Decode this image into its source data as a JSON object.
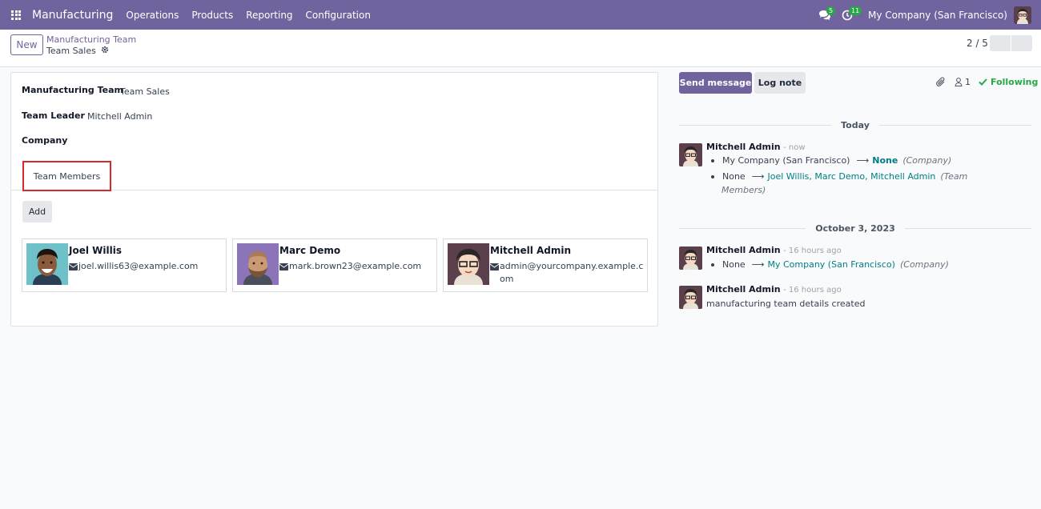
{
  "navbar": {
    "app_name": "Manufacturing",
    "menus": [
      "Operations",
      "Products",
      "Reporting",
      "Configuration"
    ],
    "messages_badge": "5",
    "activities_badge": "11",
    "company": "My Company (San Francisco)"
  },
  "control_panel": {
    "new_label": "New",
    "breadcrumb_parent": "Manufacturing Team",
    "breadcrumb_current": "Team Sales",
    "pager": "2 / 5"
  },
  "form": {
    "team_label": "Manufacturing Team",
    "team_value": "Team Sales",
    "leader_label": "Team Leader",
    "leader_value": "Mitchell Admin",
    "company_label": "Company",
    "company_value": "",
    "tab_label": "Team Members",
    "add_label": "Add",
    "members": [
      {
        "name": "Joel Willis",
        "email": "joel.willis63@example.com"
      },
      {
        "name": "Marc Demo",
        "email": "mark.brown23@example.com"
      },
      {
        "name": "Mitchell Admin",
        "email": "admin@yourcompany.example.com"
      }
    ]
  },
  "chatter": {
    "send_message": "Send message",
    "log_note": "Log note",
    "followers_count": "1",
    "following": "Following",
    "sep_today": "Today",
    "sep_oct": "October 3, 2023",
    "msg1": {
      "author": "Mitchell Admin",
      "time": "- now",
      "t1_old": "My Company (San Francisco)",
      "t1_new": "None",
      "t1_field": "(Company)",
      "t2_old": "None",
      "t2_new": "Joel Willis, Marc Demo, Mitchell Admin",
      "t2_field_a": "(Team",
      "t2_field_b": "Members)"
    },
    "msg2": {
      "author": "Mitchell Admin",
      "time": "- 16 hours ago",
      "t1_old": "None",
      "t1_new": "My Company (San Francisco)",
      "t1_field": "(Company)"
    },
    "msg3": {
      "author": "Mitchell Admin",
      "time": "- 16 hours ago",
      "body": "manufacturing team details created"
    }
  }
}
